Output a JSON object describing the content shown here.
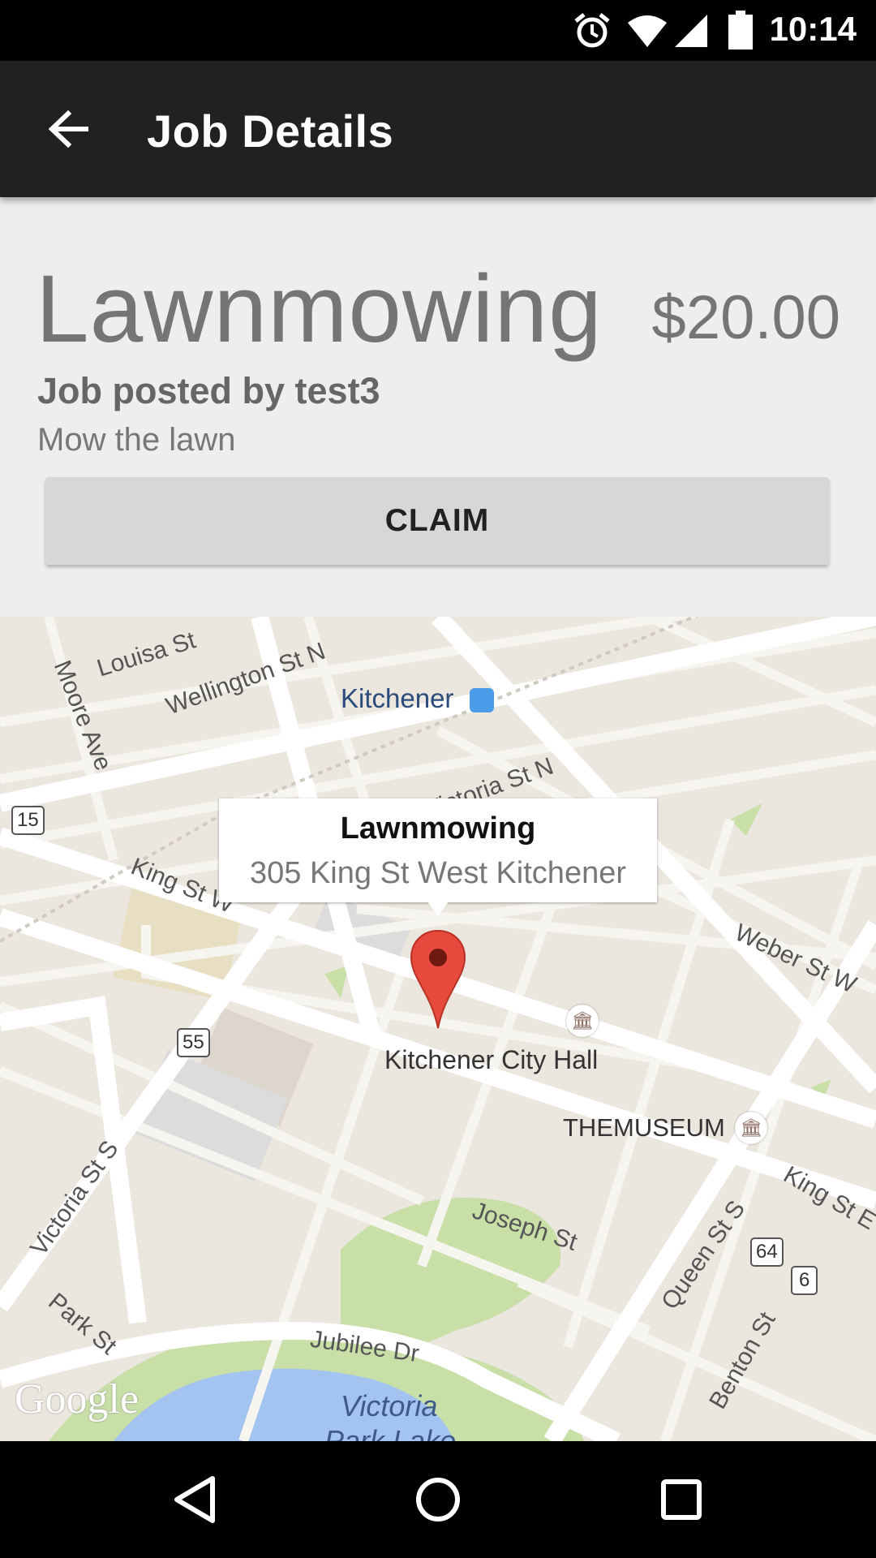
{
  "status_bar": {
    "time": "10:14",
    "icons": [
      "alarm-icon",
      "wifi-icon",
      "signal-icon",
      "battery-icon"
    ]
  },
  "app_bar": {
    "title": "Job Details",
    "back_icon": "arrow-back-icon"
  },
  "job": {
    "title": "Lawnmowing",
    "price": "$20.00",
    "posted_by": "Job posted by test3",
    "description": "Mow the lawn",
    "claim_label": "CLAIM"
  },
  "map": {
    "info_window": {
      "title": "Lawnmowing",
      "address": "305 King St West Kitchener"
    },
    "labels": {
      "louisa": "Louisa St",
      "wellington": "Wellington St N",
      "moore": "Moore Ave",
      "kitchener": "Kitchener",
      "victoria_n": "Victoria St N",
      "king_w": "King St W",
      "weber": "Weber St W",
      "city_hall": "Kitchener City Hall",
      "themuseum": "THEMUSEUM",
      "king_e": "King St E",
      "victoria_s": "Victoria St S",
      "joseph": "Joseph St",
      "queen": "Queen St S",
      "park": "Park St",
      "jubilee": "Jubilee Dr",
      "benton": "Benton St",
      "victoria_park": "Victoria",
      "victoria_park2": "Park Lake"
    },
    "shields": {
      "r15": "15",
      "r55": "55",
      "r64": "64",
      "r6": "6"
    },
    "attribution": "Google",
    "colors": {
      "road": "#ffffff",
      "land": "#ebe6de",
      "park": "#c8dfa8",
      "water": "#a3c3f0",
      "marker": "#e64a3c"
    }
  },
  "nav_bar": {
    "icons": [
      "back-triangle-icon",
      "home-circle-icon",
      "recents-square-icon"
    ]
  }
}
